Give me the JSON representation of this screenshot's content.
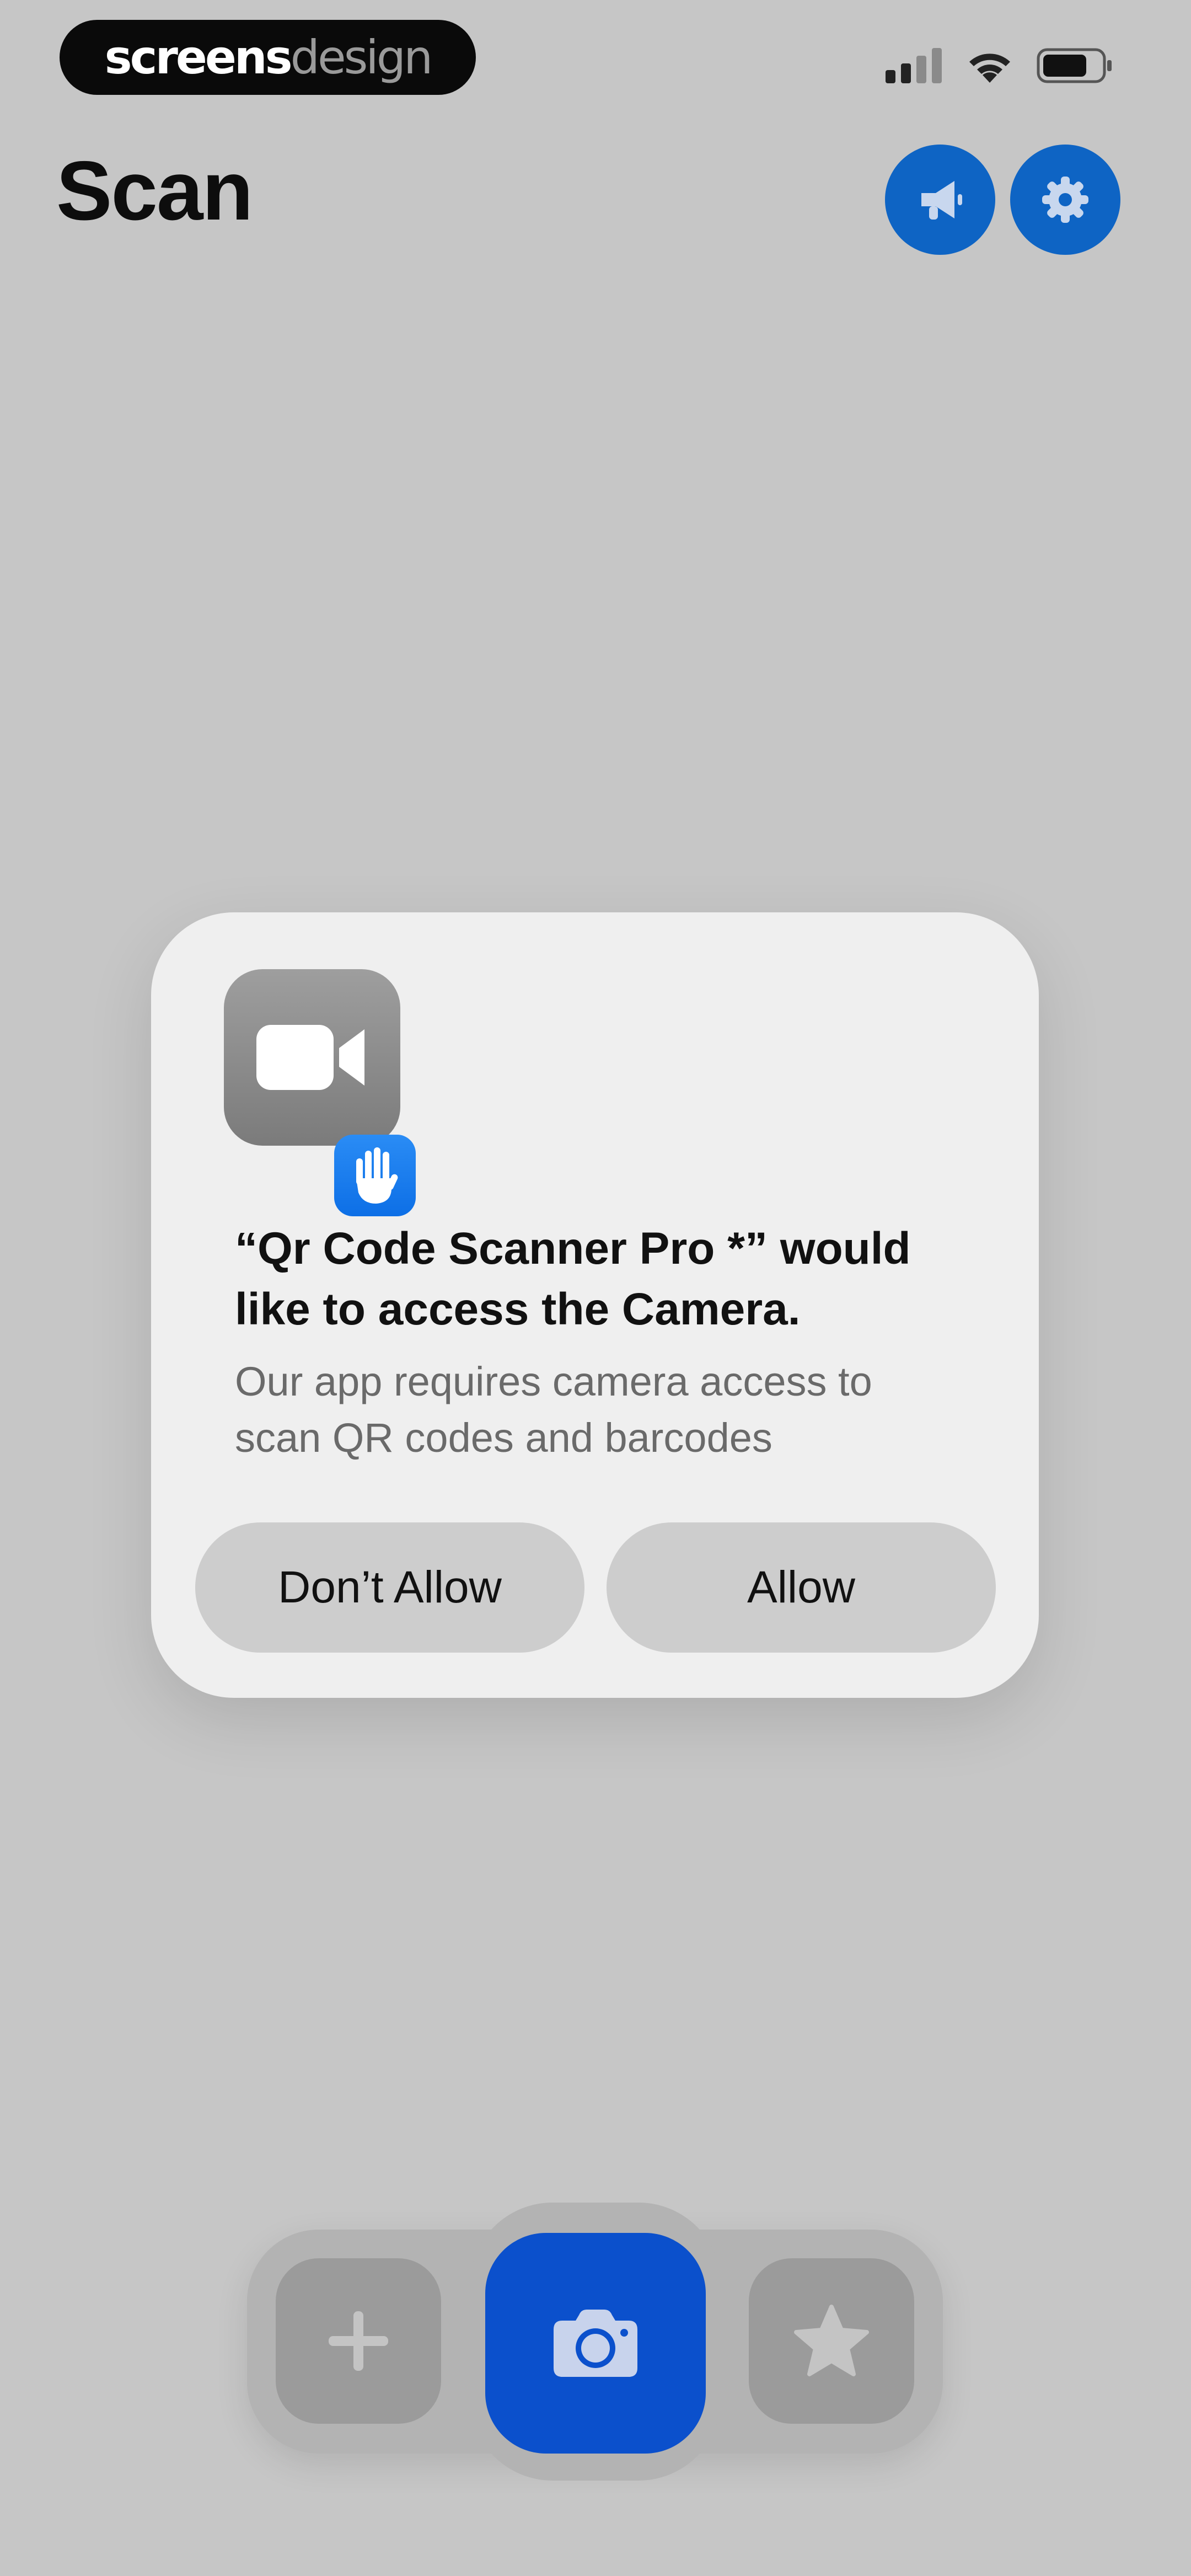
{
  "watermark": {
    "part1": "screens",
    "part2": "design"
  },
  "header": {
    "title": "Scan",
    "buttons": [
      {
        "icon": "megaphone-icon"
      },
      {
        "icon": "gear-icon"
      }
    ]
  },
  "status_bar": {
    "icons": [
      "cellular-signal-icon",
      "wifi-icon",
      "battery-icon"
    ]
  },
  "dialog": {
    "icons": [
      "video-camera-icon",
      "raised-hand-icon"
    ],
    "title": "“Qr Code Scanner Pro *” would like to access the Camera.",
    "message": "Our app requires camera access to scan QR codes and barcodes",
    "deny_label": "Don’t Allow",
    "allow_label": "Allow"
  },
  "tabbar": {
    "items": [
      {
        "icon": "plus-icon"
      },
      {
        "icon": "camera-icon",
        "selected": true
      },
      {
        "icon": "star-icon"
      }
    ]
  },
  "colors": {
    "background": "#c6c6c6",
    "accent": "#0e64c4",
    "camera_button": "#0b50cc",
    "dialog_bg": "#efefef",
    "dialog_button": "#cdcdcd"
  }
}
